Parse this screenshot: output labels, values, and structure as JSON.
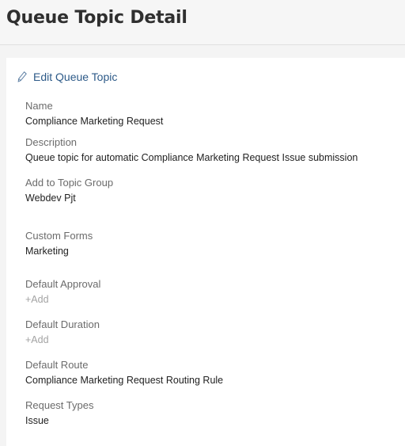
{
  "header": {
    "title": "Queue Topic Detail"
  },
  "actions": {
    "edit_label": "Edit Queue Topic"
  },
  "fields": {
    "name": {
      "label": "Name",
      "value": "Compliance Marketing Request"
    },
    "description": {
      "label": "Description",
      "value": "Queue topic for automatic Compliance Marketing Request Issue submission"
    },
    "topic_group": {
      "label": "Add to Topic Group",
      "value": "Webdev Pjt"
    },
    "custom_forms": {
      "label": "Custom Forms",
      "value": "Marketing"
    },
    "default_approval": {
      "label": "Default Approval",
      "add": "+Add"
    },
    "default_duration": {
      "label": "Default Duration",
      "add": "+Add"
    },
    "default_route": {
      "label": "Default Route",
      "value": "Compliance Marketing Request Routing Rule"
    },
    "request_types": {
      "label": "Request Types",
      "value": "Issue"
    }
  },
  "icons": {
    "edit": "pencil-icon"
  },
  "colors": {
    "link": "#2d5a88",
    "label": "#6b6b6b",
    "value": "#222222",
    "placeholder": "#a3a3a3"
  }
}
